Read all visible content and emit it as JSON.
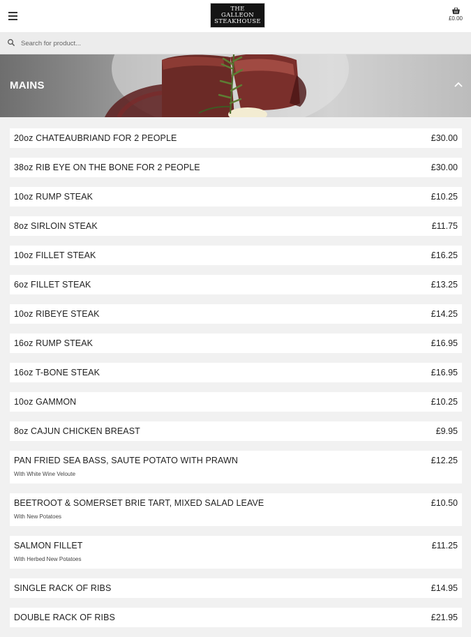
{
  "header": {
    "logo_lines": [
      "THE",
      "GALLEON",
      "STEAKHOUSE"
    ],
    "cart_total": "£0.00"
  },
  "search": {
    "placeholder": "Search for product..."
  },
  "category": {
    "title": "MAINS"
  },
  "items": [
    {
      "name": "20oz CHATEAUBRIAND FOR 2 PEOPLE",
      "price": "£30.00",
      "desc": ""
    },
    {
      "name": "38oz RIB EYE ON THE BONE FOR 2 PEOPLE",
      "price": "£30.00",
      "desc": ""
    },
    {
      "name": "10oz RUMP STEAK",
      "price": "£10.25",
      "desc": ""
    },
    {
      "name": "8oz SIRLOIN STEAK",
      "price": "£11.75",
      "desc": ""
    },
    {
      "name": "10oz FILLET STEAK",
      "price": "£16.25",
      "desc": ""
    },
    {
      "name": "6oz FILLET STEAK",
      "price": "£13.25",
      "desc": ""
    },
    {
      "name": "10oz RIBEYE STEAK",
      "price": "£14.25",
      "desc": ""
    },
    {
      "name": "16oz RUMP STEAK",
      "price": "£16.95",
      "desc": ""
    },
    {
      "name": "16oz T-BONE STEAK",
      "price": "£16.95",
      "desc": ""
    },
    {
      "name": "10oz GAMMON",
      "price": "£10.25",
      "desc": ""
    },
    {
      "name": "8oz CAJUN CHICKEN BREAST",
      "price": "£9.95",
      "desc": ""
    },
    {
      "name": "PAN FRIED SEA BASS, SAUTE POTATO WITH PRAWN",
      "price": "£12.25",
      "desc": "With White Wine Veloute"
    },
    {
      "name": "BEETROOT & SOMERSET BRIE TART, MIXED SALAD LEAVE",
      "price": "£10.50",
      "desc": "With New Potatoes"
    },
    {
      "name": "SALMON FILLET",
      "price": "£11.25",
      "desc": "With Herbed New Potatoes"
    },
    {
      "name": "SINGLE RACK OF RIBS",
      "price": "£14.95",
      "desc": ""
    },
    {
      "name": "DOUBLE RACK OF RIBS",
      "price": "£21.95",
      "desc": ""
    }
  ],
  "icons": {
    "menu": "hamburger-menu-icon",
    "cart": "shopping-basket-icon",
    "search": "search-icon",
    "collapse": "chevron-up-icon"
  },
  "colors": {
    "background": "#f1f1f1",
    "card": "#ffffff",
    "logo_bg": "#141414"
  }
}
